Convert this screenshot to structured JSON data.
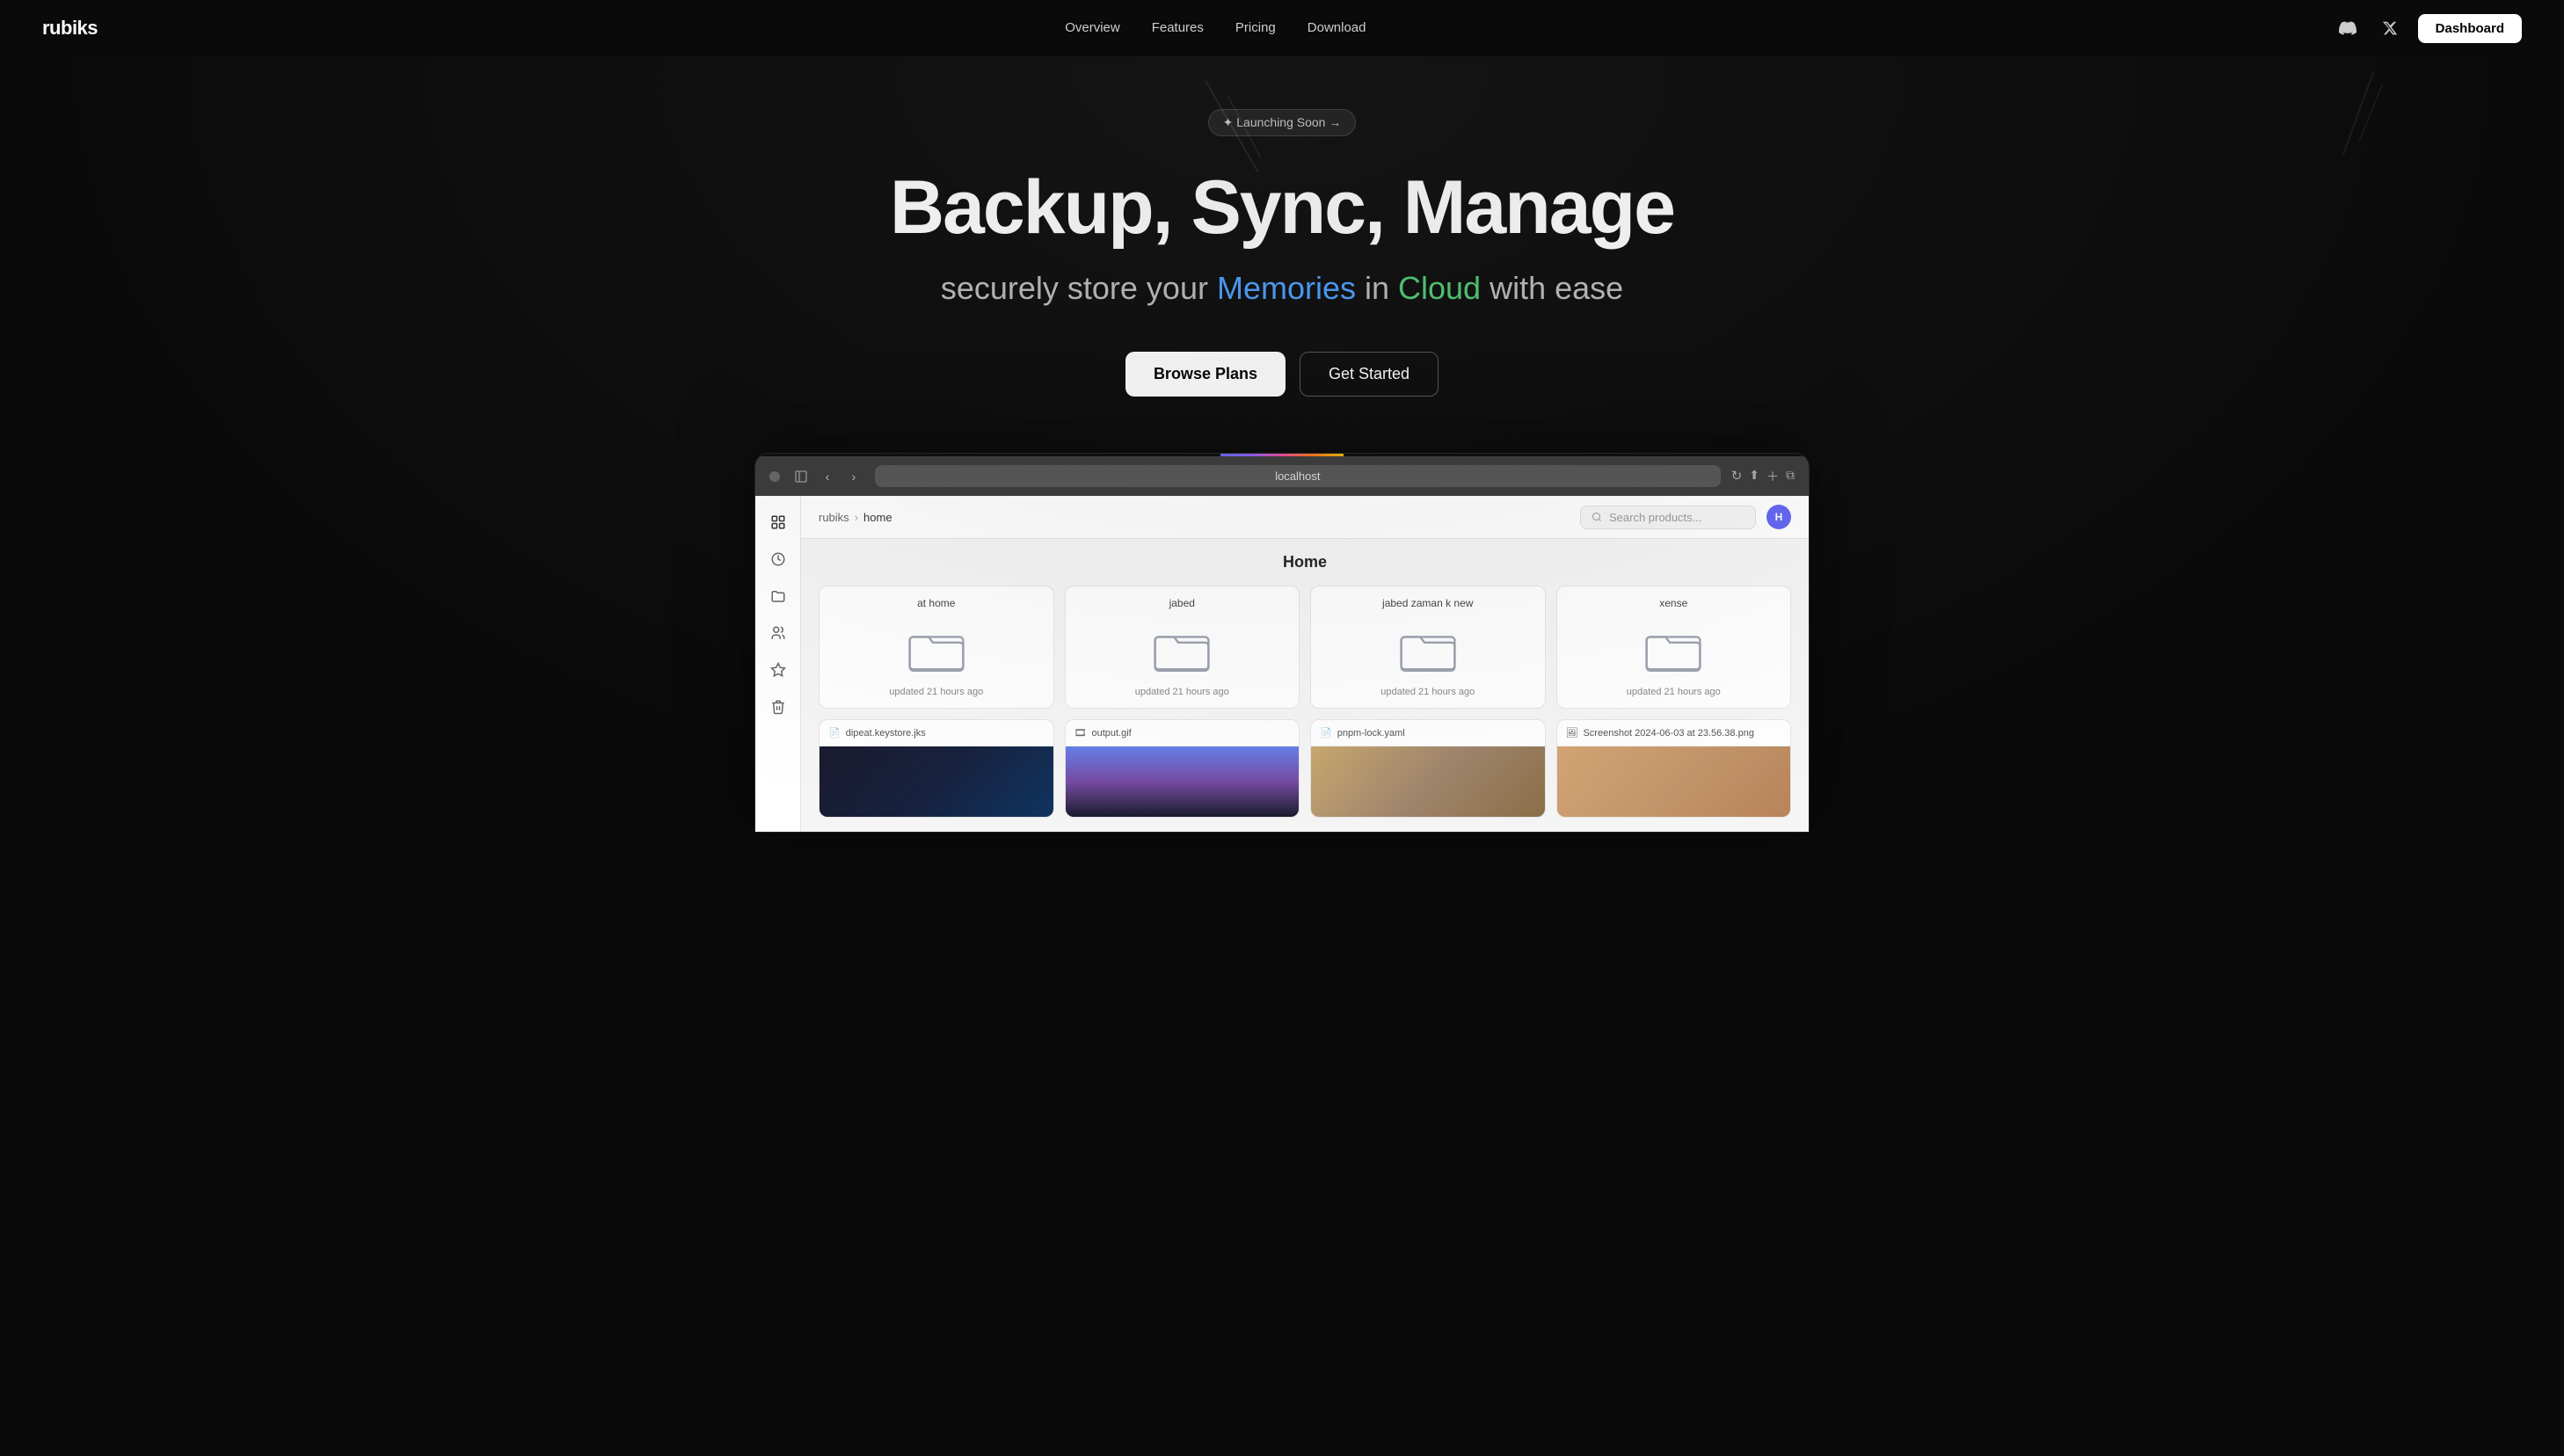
{
  "nav": {
    "logo": "rubiks",
    "links": [
      "Overview",
      "Features",
      "Pricing",
      "Download"
    ],
    "dashboard_label": "Dashboard",
    "discord_icon": "discord",
    "twitter_icon": "twitter"
  },
  "hero": {
    "launch_badge": "✦ Launching Soon →",
    "title": "Backup, Sync, Manage",
    "subtitle_prefix": "securely store your ",
    "subtitle_memories": "Memories",
    "subtitle_middle": " in ",
    "subtitle_cloud": "Cloud",
    "subtitle_suffix": " with ease",
    "btn_browse": "Browse Plans",
    "btn_started": "Get Started"
  },
  "browser": {
    "url": "localhost",
    "reload_icon": "↻"
  },
  "app": {
    "breadcrumb_root": "rubiks",
    "breadcrumb_current": "home",
    "search_placeholder": "Search products...",
    "avatar_label": "H",
    "page_title": "Home",
    "folders": [
      {
        "name": "at home",
        "updated": "updated 21 hours ago"
      },
      {
        "name": "jabed",
        "updated": "updated 21 hours ago"
      },
      {
        "name": "jabed zaman k new",
        "updated": "updated 21 hours ago"
      },
      {
        "name": "xense",
        "updated": "updated 21 hours ago"
      }
    ],
    "files": [
      {
        "name": "dipeat.keystore.jks",
        "icon": "📄",
        "thumb_class": "thumb-dark"
      },
      {
        "name": "output.gif",
        "icon": "🎞",
        "thumb_class": "thumb-ocean"
      },
      {
        "name": "pnpm-lock.yaml",
        "icon": "📄",
        "thumb_class": "thumb-sand"
      },
      {
        "name": "Screenshot 2024-06-03 at 23.56.38.png",
        "icon": "🖼",
        "thumb_class": "thumb-room"
      }
    ]
  }
}
